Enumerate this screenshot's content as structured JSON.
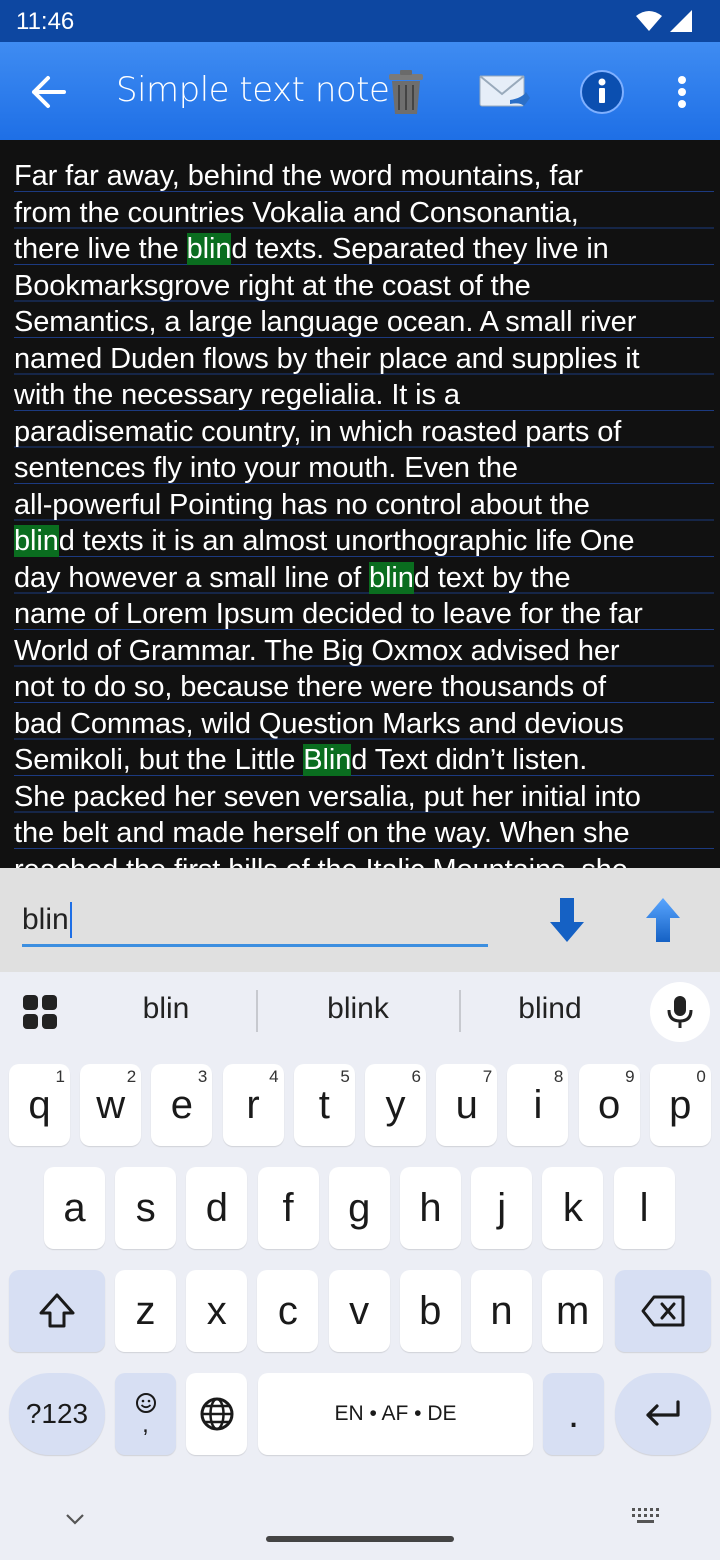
{
  "status_bar": {
    "time": "11:46"
  },
  "app_bar": {
    "title": "Simple text note",
    "actions": [
      "trash-icon",
      "mail-icon",
      "info-icon",
      "more-icon"
    ]
  },
  "note": {
    "lines": [
      [
        "Far far away, behind the word mountains, far"
      ],
      [
        "from the countries Vokalia and Consonantia,"
      ],
      [
        "there live the ",
        {
          "hl": "blin"
        },
        "d texts. Separated they live in"
      ],
      [
        "Bookmarksgrove right at the coast of the"
      ],
      [
        "Semantics, a large language ocean. A small river"
      ],
      [
        "named Duden flows by their place and supplies it"
      ],
      [
        "with the necessary regelialia. It is a"
      ],
      [
        "paradisematic country, in which roasted parts of"
      ],
      [
        "sentences fly into your mouth. Even the"
      ],
      [
        "all-powerful Pointing has no control about the"
      ],
      [
        {
          "hl": "blin"
        },
        "d texts it is an almost unorthographic life One"
      ],
      [
        "day however a small line of ",
        {
          "hl": "blin"
        },
        "d text by the"
      ],
      [
        "name of Lorem Ipsum decided to leave for the far"
      ],
      [
        "World of Grammar. The Big Oxmox advised her"
      ],
      [
        "not to do so, because there were thousands of"
      ],
      [
        "bad Commas, wild Question Marks and devious"
      ],
      [
        "Semikoli, but the Little ",
        {
          "hl": "Blin"
        },
        "d Text didn’t listen."
      ],
      [
        "She packed her seven versalia, put her initial into"
      ],
      [
        "the belt and made herself on the way. When she"
      ],
      [
        "reached the first hills of the Italic Mountains, she"
      ]
    ]
  },
  "search": {
    "value": "blin"
  },
  "keyboard": {
    "suggestions": [
      "blin",
      "blink",
      "blind"
    ],
    "row1": [
      {
        "k": "q",
        "d": "1"
      },
      {
        "k": "w",
        "d": "2"
      },
      {
        "k": "e",
        "d": "3"
      },
      {
        "k": "r",
        "d": "4"
      },
      {
        "k": "t",
        "d": "5"
      },
      {
        "k": "y",
        "d": "6"
      },
      {
        "k": "u",
        "d": "7"
      },
      {
        "k": "i",
        "d": "8"
      },
      {
        "k": "o",
        "d": "9"
      },
      {
        "k": "p",
        "d": "0"
      }
    ],
    "row2": [
      "a",
      "s",
      "d",
      "f",
      "g",
      "h",
      "j",
      "k",
      "l"
    ],
    "row3": [
      "z",
      "x",
      "c",
      "v",
      "b",
      "n",
      "m"
    ],
    "symbols_label": "?123",
    "emoji_sub": ",",
    "space_label": "EN • AF • DE",
    "period_label": "."
  },
  "colors": {
    "highlight": "#0a6d1f",
    "app_bar": "#1e6fe6",
    "status_bar": "#0d47a1"
  }
}
